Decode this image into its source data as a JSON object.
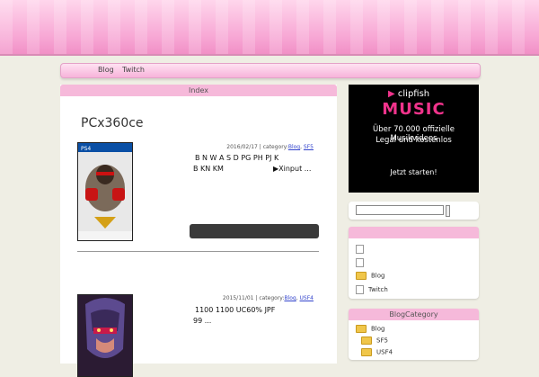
{
  "nav": {
    "items": [
      "Blog",
      "Twitch"
    ]
  },
  "main": {
    "index_label": "Index",
    "title": "PCx360ce",
    "posts": [
      {
        "date": "2016/02/17 | category:",
        "cat1": "Blog",
        "cat2": "SF5",
        "line1": "B N W A S D PG PH PJ K",
        "line2": "B KN KM",
        "line2b": "▶Xinput ..."
      },
      {
        "date": "2015/11/01 | category:",
        "cat1": "Blog",
        "cat2": "USF4",
        "line1": "1100 1100 UC60% JPF",
        "line2": "99 ..."
      }
    ]
  },
  "ad": {
    "logo": "clipfish",
    "headline": "MUSIC",
    "line1": "Über 70.000 offizielle Musikvideos",
    "line2": "Legal und kostenlos",
    "cta": "Jetzt starten!"
  },
  "sidebar": {
    "links": [
      "Blog",
      "Twitch"
    ],
    "category_title": "BlogCategory",
    "categories": [
      "Blog",
      "SF5",
      "USF4"
    ]
  },
  "colors": {
    "pink": "#f6b9da",
    "header": "#f7a6d4",
    "ad_accent": "#f0338b"
  }
}
